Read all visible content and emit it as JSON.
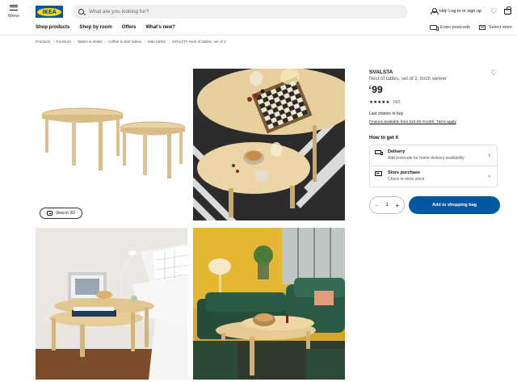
{
  "header": {
    "menu_label": "Menu",
    "logo_text": "IKEA",
    "search_placeholder": "What are you looking for?",
    "account_label": "Hej! Log in or sign up"
  },
  "nav": {
    "items": [
      "Shop products",
      "Shop by room",
      "Offers",
      "What's new?"
    ],
    "postcode_label": "Enter postcode",
    "store_label": "Select store"
  },
  "breadcrumb": [
    "Products",
    "Furniture",
    "Tables & desks",
    "Coffee & side tables",
    "Side tables",
    "SVALSTA Nest of tables, set of 2"
  ],
  "gallery": {
    "view3d_label": "View in 3D"
  },
  "product": {
    "name": "SVALSTA",
    "description": "Nest of tables, set of 2, birch veneer",
    "price_currency": "£",
    "price_value": "99",
    "stars": "★★★★★",
    "review_count": "(42)",
    "last_chance": "Last chance to buy",
    "finance": "Finance available from £16.50 /month, T&Cs apply",
    "how_to_get": "How to get it",
    "delivery": {
      "title": "Delivery",
      "subtitle": "Add postcode for home delivery availability"
    },
    "store_purchase": {
      "title": "Store purchase",
      "subtitle": "Check in-store stock"
    },
    "quantity": "1",
    "add_label": "Add to shopping bag"
  },
  "colors": {
    "ikea_blue": "#0058a3",
    "ikea_yellow": "#ffdb00"
  },
  "icons": [
    "menu-icon",
    "search-icon",
    "user-icon",
    "heart-icon",
    "shopping-bag-icon",
    "truck-icon",
    "store-icon",
    "cube-3d-icon",
    "chevron-right-icon"
  ]
}
